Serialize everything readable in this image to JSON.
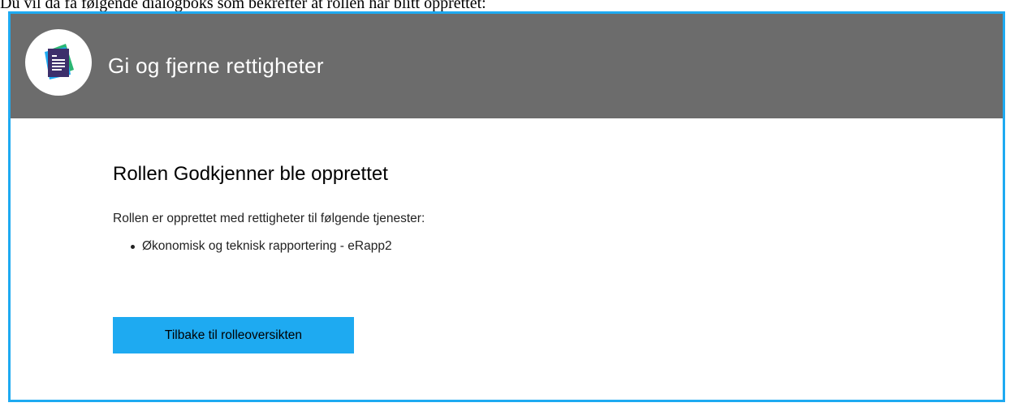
{
  "page": {
    "caption": "Du vil da få følgende dialogboks som bekrefter at rollen har blitt opprettet:"
  },
  "dialog": {
    "title": "Gi og fjerne rettigheter",
    "icon": "document-icon",
    "colors": {
      "header_bg": "#6c6c6c",
      "border": "#1eaaf1",
      "button_bg": "#1eaaf1",
      "icon_back": "#2bb673",
      "icon_mid": "#1eaaf1",
      "icon_front": "#3d2f6b"
    }
  },
  "content": {
    "heading": "Rollen Godkjenner ble opprettet",
    "intro": "Rollen er opprettet med rettigheter til følgende tjenester:",
    "services": [
      "Økonomisk og teknisk rapportering - eRapp2"
    ],
    "back_button_label": "Tilbake til rolleoversikten"
  }
}
